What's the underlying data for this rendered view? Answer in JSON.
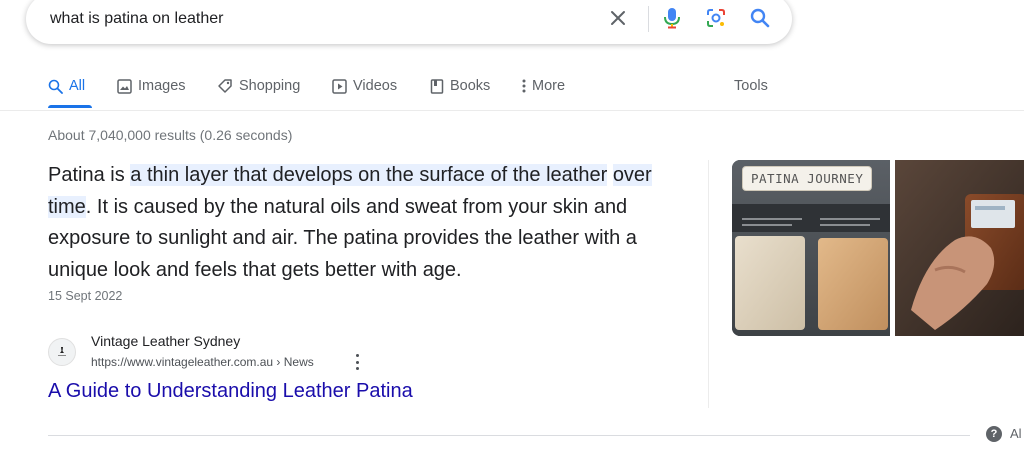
{
  "search": {
    "query": "what is patina on leather",
    "icons": [
      "close-icon",
      "mic-icon",
      "lens-icon",
      "search-icon"
    ]
  },
  "tabs": [
    {
      "label": "All",
      "icon": "search-icon",
      "active": true
    },
    {
      "label": "Images",
      "icon": "image-icon"
    },
    {
      "label": "Shopping",
      "icon": "tag-icon"
    },
    {
      "label": "Videos",
      "icon": "play-icon"
    },
    {
      "label": "Books",
      "icon": "book-icon"
    },
    {
      "label": "More",
      "icon": "more-vert-icon"
    }
  ],
  "tools_label": "Tools",
  "stats": "About 7,040,000 results (0.26 seconds)",
  "snippet": {
    "lead": "Patina is ",
    "highlight_1": "a thin layer that develops on the surface of the leather",
    "highlight_2": "over time",
    "rest": ". It is caused by the natural oils and sweat from your skin and exposure to sunlight and air. The patina provides the leather with a unique look and feels that gets better with age.",
    "date": "15 Sept 2022"
  },
  "source": {
    "name": "Vintage Leather Sydney",
    "url": "https://www.vintageleather.com.au › News",
    "title": "A Guide to Understanding Leather Patina"
  },
  "images": {
    "thumb1_label": "PATINA JOURNEY"
  },
  "footer": {
    "help_text": "Al"
  },
  "colors": {
    "accent": "#1a73e8",
    "link": "#1a0dab",
    "highlight": "#e8f0fe"
  }
}
